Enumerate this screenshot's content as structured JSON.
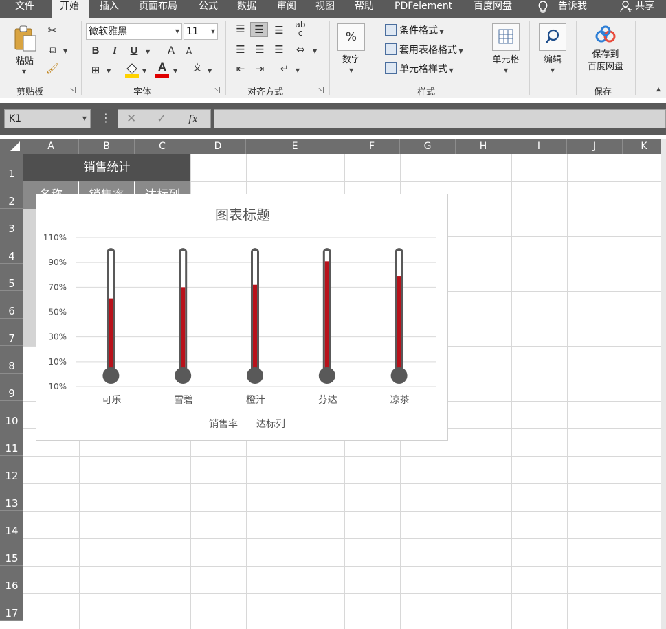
{
  "tabs": [
    "文件",
    "开始",
    "插入",
    "页面布局",
    "公式",
    "数据",
    "审阅",
    "视图",
    "帮助",
    "PDFelement",
    "百度网盘",
    "告诉我",
    "共享"
  ],
  "ribbon": {
    "clipboard": {
      "paste": "粘贴",
      "group": "剪贴板"
    },
    "font": {
      "name": "微软雅黑",
      "size": "11",
      "group": "字体",
      "bold": "B",
      "italic": "I",
      "underline": "U",
      "grow": "A",
      "shrink": "A",
      "fontcolor": "A"
    },
    "align": {
      "group": "对齐方式"
    },
    "number": {
      "label": "数字"
    },
    "styles": {
      "cond": "条件格式",
      "table": "套用表格格式",
      "cell": "单元格样式",
      "group": "样式"
    },
    "cells": {
      "label": "单元格"
    },
    "edit": {
      "label": "编辑"
    },
    "save": {
      "line1": "保存到",
      "line2": "百度网盘",
      "group": "保存"
    },
    "percent": "%"
  },
  "formula_bar": {
    "namebox": "K1",
    "fx": "fx",
    "value": ""
  },
  "columns": [
    "A",
    "B",
    "C",
    "D",
    "E",
    "F",
    "G",
    "H",
    "I",
    "J",
    "K"
  ],
  "rows": [
    "1",
    "2",
    "3",
    "4",
    "5",
    "6",
    "7",
    "8",
    "9",
    "10",
    "11",
    "12",
    "13",
    "14",
    "15",
    "16",
    "17"
  ],
  "cells": {
    "A1": "销售统计",
    "A2": "名称",
    "B2": "销售率",
    "C2": "达标列"
  },
  "chart_data": {
    "type": "bar",
    "title": "图表标题",
    "categories": [
      "可乐",
      "雪碧",
      "橙汁",
      "芬达",
      "凉茶"
    ],
    "series": [
      {
        "name": "销售率",
        "values": [
          0.61,
          0.7,
          0.72,
          0.91,
          0.79
        ],
        "color": "#b8121b"
      },
      {
        "name": "达标列",
        "values": [
          1.0,
          1.0,
          1.0,
          1.0,
          1.0
        ],
        "color": "#595959"
      }
    ],
    "yticks": [
      "110%",
      "90%",
      "70%",
      "50%",
      "30%",
      "10%",
      "-10%"
    ],
    "ylim": [
      -0.1,
      1.1
    ],
    "gridlines": true,
    "legend_position": "bottom",
    "colors": {
      "tube": "#595959",
      "fill": "#b8121b",
      "bulb": "#595959"
    }
  }
}
